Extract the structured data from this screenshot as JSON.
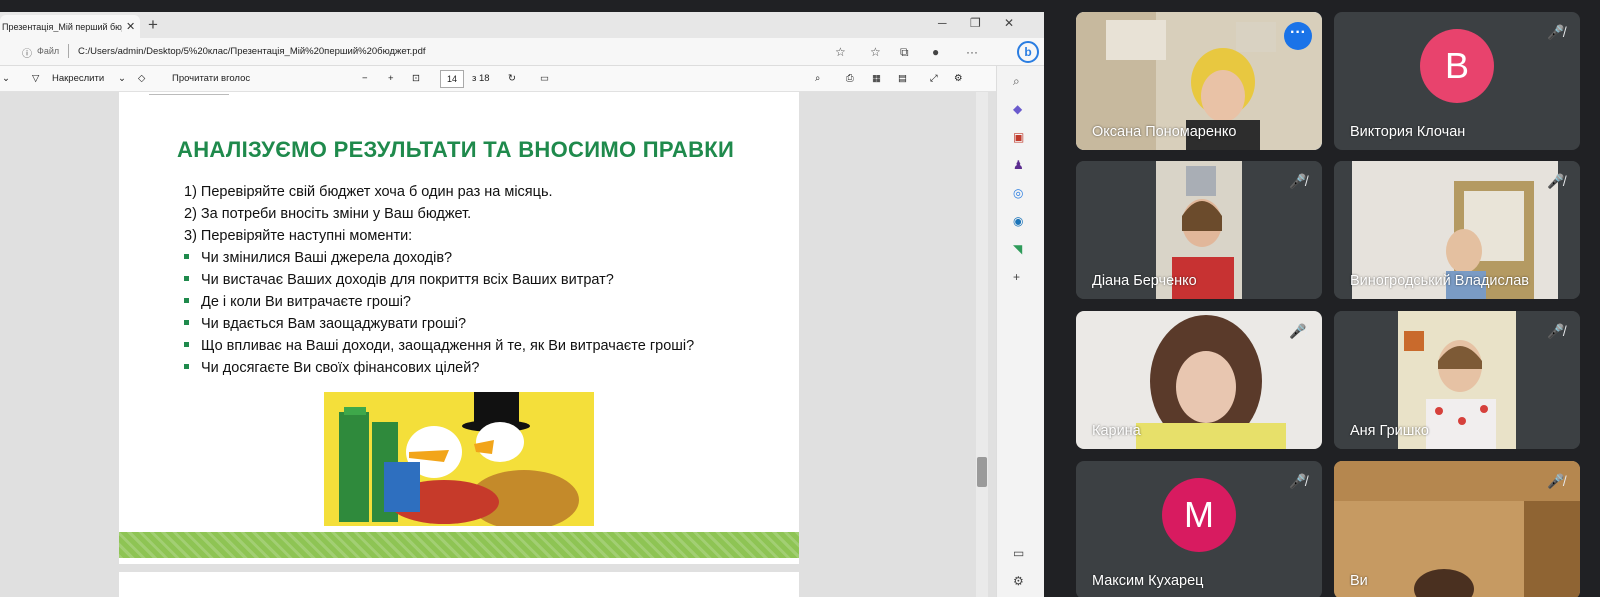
{
  "browser": {
    "tab_title": "Презентація_Мій перший бюдж",
    "scheme_label": "Файл",
    "url": "C:/Users/admin/Desktop/5%20клас/Презентація_Мій%20перший%20бюджет.pdf"
  },
  "pdf": {
    "draw_label": "Накреслити",
    "read_aloud_label": "Прочитати вголос",
    "page_current": "14",
    "page_total_label": "з 18"
  },
  "slide": {
    "title": "АНАЛІЗУЄМО РЕЗУЛЬТАТИ ТА ВНОСИМО ПРАВКИ",
    "numbered": [
      "1) Перевіряйте свій бюджет хоча б один раз на місяць.",
      "2) За потреби вносіть зміни у Ваш бюджет.",
      "3) Перевіряйте наступні моменти:"
    ],
    "bullets": [
      "Чи змінилися Ваші джерела доходів?",
      "Чи вистачає Ваших доходів для покриття всіх Ваших витрат?",
      "Де і коли Ви витрачаєте гроші?",
      "Чи вдається Вам заощаджувати гроші?",
      "Що впливає на Ваші доходи, заощадження й те, як Ви витрачаєте гроші?",
      "Чи досягаєте Ви своїх фінансових цілей?"
    ]
  },
  "participants": [
    {
      "name": "Оксана Пономаренко"
    },
    {
      "name": "Виктория Клочан",
      "initial": "В"
    },
    {
      "name": "Діана Берченко"
    },
    {
      "name": "Виногродський Владислав"
    },
    {
      "name": "Карина"
    },
    {
      "name": "Аня Гришко"
    },
    {
      "name": "Максим Кухарец",
      "initial": "М"
    },
    {
      "name": "Ви"
    }
  ],
  "colors": {
    "slide_title": "#1f8a4c",
    "active_speaker_border": "#8ab4f8",
    "meet_background": "#202124"
  }
}
